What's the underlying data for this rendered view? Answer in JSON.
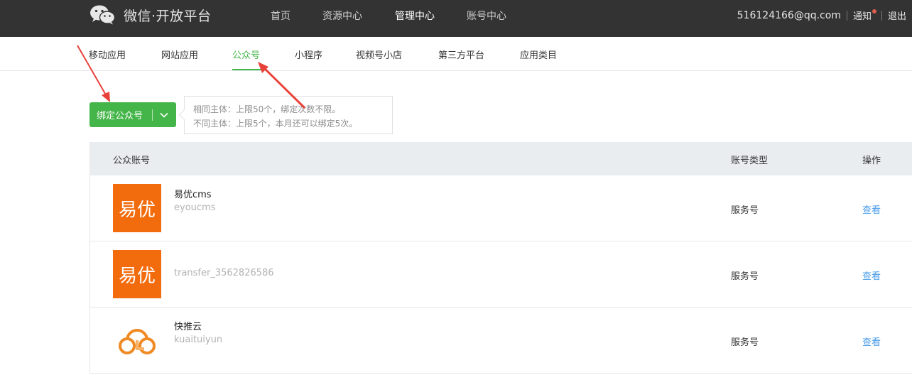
{
  "header": {
    "logo_text": "微信·开放平台",
    "nav": [
      {
        "label": "首页",
        "active": false
      },
      {
        "label": "资源中心",
        "active": false
      },
      {
        "label": "管理中心",
        "active": true
      },
      {
        "label": "账号中心",
        "active": false
      }
    ],
    "email": "516124166@qq.com",
    "notice_label": "通知",
    "logout_label": "退出"
  },
  "subnav": {
    "items": [
      {
        "label": "移动应用",
        "active": false
      },
      {
        "label": "网站应用",
        "active": false
      },
      {
        "label": "公众号",
        "active": true
      },
      {
        "label": "小程序",
        "active": false
      },
      {
        "label": "视频号小店",
        "active": false
      },
      {
        "label": "第三方平台",
        "active": false
      },
      {
        "label": "应用类目",
        "active": false
      }
    ]
  },
  "bind": {
    "button_label": "绑定公众号",
    "tip_line1": "相同主体：上限50个，绑定次数不限。",
    "tip_line2": "不同主体：上限5个，本月还可以绑定5次。"
  },
  "table": {
    "headers": {
      "account": "公众账号",
      "type": "账号类型",
      "action": "操作"
    },
    "rows": [
      {
        "name": "易优cms",
        "sub": "eyoucms",
        "type": "服务号",
        "action": "查看",
        "avatar": "eyou-logo",
        "avatar_text": "易优"
      },
      {
        "name": "",
        "sub": "transfer_3562826586",
        "type": "服务号",
        "action": "查看",
        "avatar": "eyou-logo",
        "avatar_text": "易优"
      },
      {
        "name": "快推云",
        "sub": "kuaituiyun",
        "type": "服务号",
        "action": "查看",
        "avatar": "cloud-logo",
        "avatar_text": ""
      }
    ]
  },
  "colors": {
    "topbar": "#333333",
    "accent": "#44b549",
    "link": "#459ae9",
    "annotation": "#e8413a",
    "eyou_orange": "#f26b0c"
  }
}
